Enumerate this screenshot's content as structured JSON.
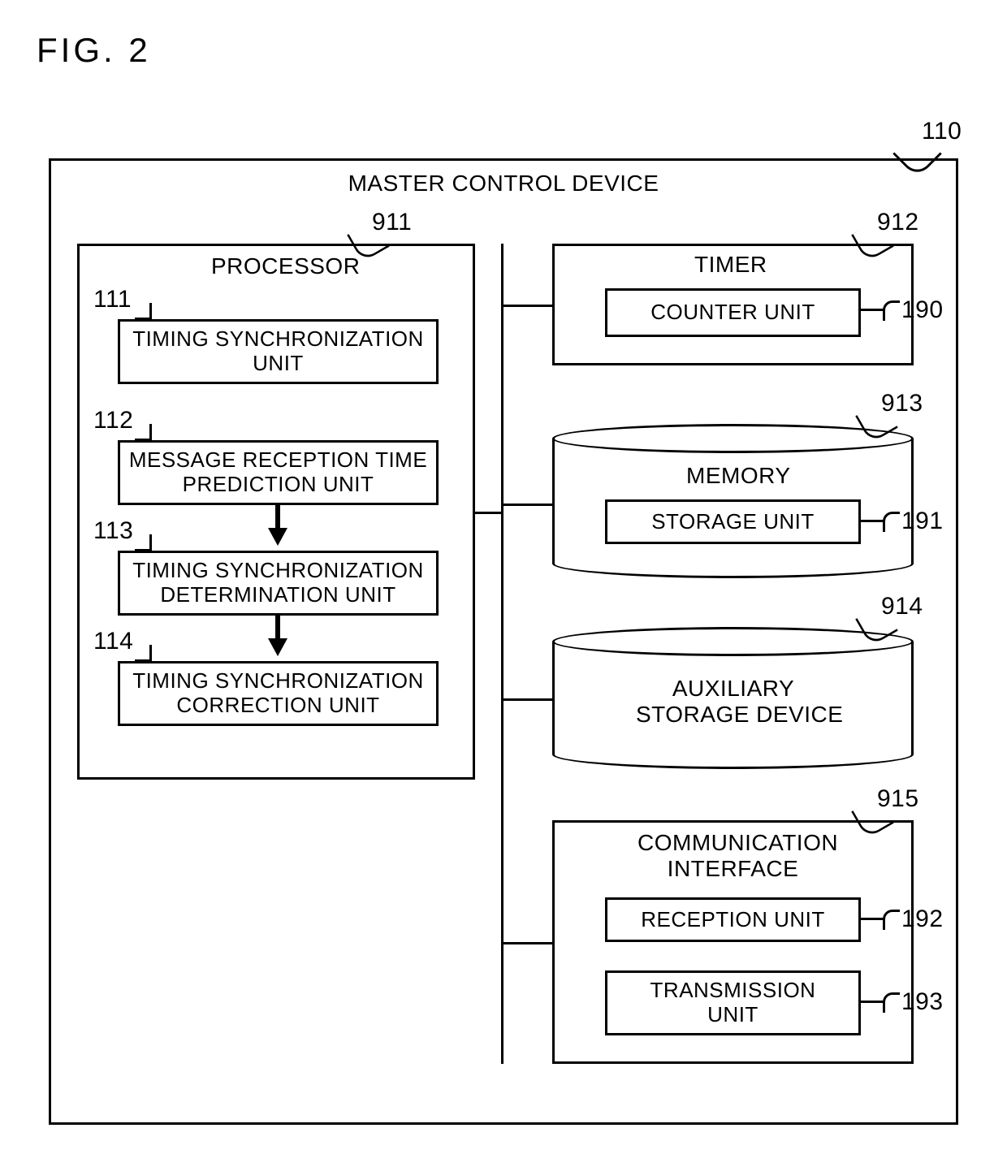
{
  "figure": "FIG. 2",
  "device": {
    "title": "MASTER CONTROL DEVICE",
    "ref": "110"
  },
  "processor": {
    "title": "PROCESSOR",
    "ref": "911",
    "units": {
      "u111": {
        "ref": "111",
        "label": "TIMING SYNCHRONIZATION\nUNIT"
      },
      "u112": {
        "ref": "112",
        "label": "MESSAGE RECEPTION TIME\nPREDICTION UNIT"
      },
      "u113": {
        "ref": "113",
        "label": "TIMING SYNCHRONIZATION\nDETERMINATION UNIT"
      },
      "u114": {
        "ref": "114",
        "label": "TIMING SYNCHRONIZATION\nCORRECTION UNIT"
      }
    }
  },
  "timer": {
    "title": "TIMER",
    "ref": "912",
    "counter": {
      "label": "COUNTER UNIT",
      "ref": "190"
    }
  },
  "memory": {
    "title": "MEMORY",
    "ref": "913",
    "storage": {
      "label": "STORAGE UNIT",
      "ref": "191"
    }
  },
  "aux": {
    "title": "AUXILIARY\nSTORAGE DEVICE",
    "ref": "914"
  },
  "comm": {
    "title": "COMMUNICATION\nINTERFACE",
    "ref": "915",
    "reception": {
      "label": "RECEPTION UNIT",
      "ref": "192"
    },
    "transmission": {
      "label": "TRANSMISSION\nUNIT",
      "ref": "193"
    }
  }
}
